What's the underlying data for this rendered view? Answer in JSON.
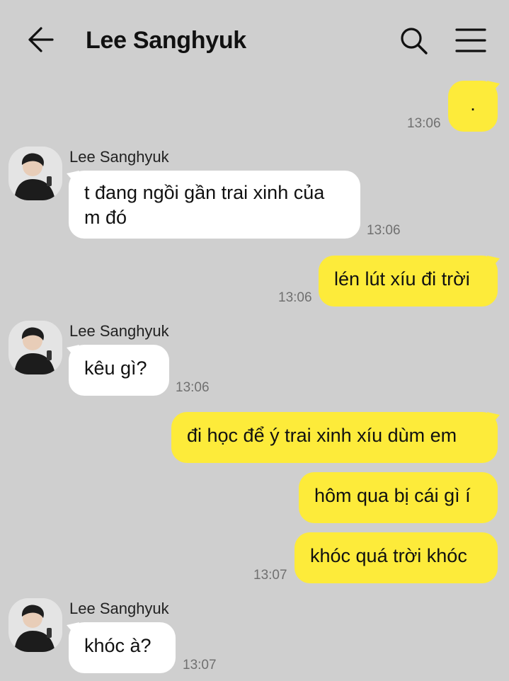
{
  "header": {
    "back_icon": "arrow-left-icon",
    "title": "Lee Sanghyuk",
    "search_icon": "search-icon",
    "menu_icon": "hamburger-menu-icon"
  },
  "colors": {
    "background": "#cfcfcf",
    "outgoing_bubble": "#fdeb3a",
    "incoming_bubble": "#ffffff"
  },
  "messages": [
    {
      "direction": "out",
      "text": ".",
      "time": "13:06"
    },
    {
      "direction": "in",
      "sender": "Lee Sanghyuk",
      "text": "t đang ngồi gần trai xinh của m đó",
      "time": "13:06"
    },
    {
      "direction": "out",
      "text": "lén lút xíu đi trời",
      "time": "13:06"
    },
    {
      "direction": "in",
      "sender": "Lee Sanghyuk",
      "text": "kêu gì?",
      "time": "13:06"
    },
    {
      "direction": "out",
      "text": "đi học để ý trai xinh xíu dùm em"
    },
    {
      "direction": "out",
      "text": "hôm qua bị cái gì í"
    },
    {
      "direction": "out",
      "text": "khóc quá trời khóc",
      "time": "13:07"
    },
    {
      "direction": "in",
      "sender": "Lee Sanghyuk",
      "text": "khóc à?",
      "time": "13:07"
    }
  ]
}
